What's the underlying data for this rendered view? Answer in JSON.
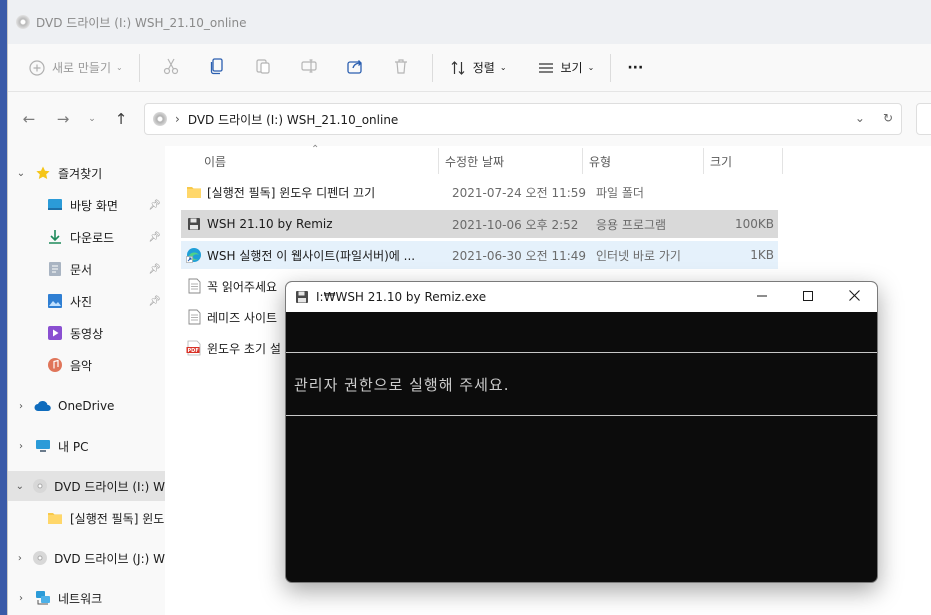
{
  "window": {
    "title": "DVD 드라이브 (I:) WSH_21.10_online"
  },
  "toolbar": {
    "new_label": "새로 만들기",
    "sort_label": "정렬",
    "view_label": "보기",
    "more_label": "···"
  },
  "address": {
    "path": "DVD 드라이브 (I:) WSH_21.10_online",
    "separator": "›"
  },
  "sidebar": {
    "items": [
      {
        "label": "즐겨찾기"
      },
      {
        "label": "바탕 화면"
      },
      {
        "label": "다운로드"
      },
      {
        "label": "문서"
      },
      {
        "label": "사진"
      },
      {
        "label": "동영상"
      },
      {
        "label": "음악"
      },
      {
        "label": "OneDrive"
      },
      {
        "label": "내 PC"
      },
      {
        "label": "DVD 드라이브 (I:) W"
      },
      {
        "label": "[실행전 필독] 윈도"
      },
      {
        "label": "DVD 드라이브 (J:) W"
      },
      {
        "label": "네트워크"
      }
    ]
  },
  "columns": {
    "name": "이름",
    "date": "수정한 날짜",
    "type": "유형",
    "size": "크기"
  },
  "files": [
    {
      "name": "[실행전 필독] 윈도우 디펜더 끄기",
      "date": "2021-07-24 오전 11:59",
      "type": "파일 폴더",
      "size": ""
    },
    {
      "name": "WSH 21.10 by Remiz",
      "date": "2021-10-06 오후 2:52",
      "type": "응용 프로그램",
      "size": "100KB"
    },
    {
      "name": "WSH 실행전 이 웹사이트(파일서버)에 ...",
      "date": "2021-06-30 오전 11:49",
      "type": "인터넷 바로 가기",
      "size": "1KB"
    },
    {
      "name": "꼭 읽어주세요",
      "date": "",
      "type": "",
      "size": ""
    },
    {
      "name": "레미즈 사이트",
      "date": "",
      "type": "",
      "size": ""
    },
    {
      "name": "윈도우 초기 설",
      "date": "",
      "type": "",
      "size": ""
    }
  ],
  "console": {
    "title": "I:₩WSH 21.10 by Remiz.exe",
    "message": "관리자 권한으로 실행해 주세요."
  }
}
